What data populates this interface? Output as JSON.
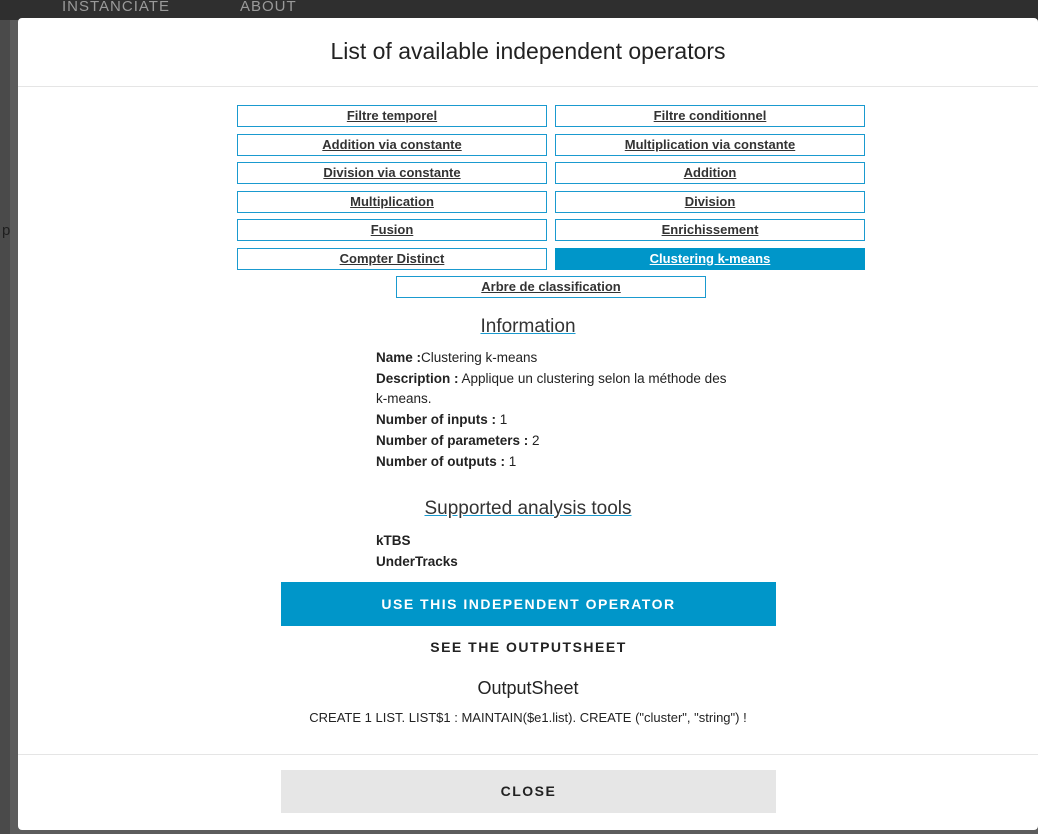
{
  "background": {
    "nav_items": [
      "INSTANCIATE",
      "ABOUT"
    ],
    "side_letter": "p"
  },
  "modal": {
    "title": "List of available independent operators",
    "operators": [
      "Filtre temporel",
      "Filtre conditionnel",
      "Addition via constante",
      "Multiplication via constante",
      "Division via constante",
      "Addition",
      "Multiplication",
      "Division",
      "Fusion",
      "Enrichissement",
      "Compter Distinct",
      "Clustering k-means",
      "Arbre de classification"
    ],
    "selected_operator": "Clustering k-means",
    "information": {
      "title": "Information",
      "name_label": "Name :",
      "name_value": "Clustering k-means",
      "description_label": "Description :",
      "description_value": " Applique un clustering selon la méthode des k-means.",
      "inputs_label": "Number of inputs :",
      "inputs_value": " 1",
      "parameters_label": "Number of parameters :",
      "parameters_value": " 2",
      "outputs_label": "Number of outputs :",
      "outputs_value": " 1"
    },
    "tools": {
      "title": "Supported analysis tools",
      "items": [
        "kTBS",
        "UnderTracks"
      ]
    },
    "use_button": "USE THIS INDEPENDENT OPERATOR",
    "see_button": "SEE THE OUTPUTSHEET",
    "output_title": "OutputSheet",
    "output_text": "CREATE 1 LIST. LIST$1 : MAINTAIN($e1.list). CREATE (\"cluster\", \"string\") !",
    "close_button": "CLOSE"
  },
  "colors": {
    "accent": "#0096c9",
    "border": "#1a9acf",
    "close_bg": "#e6e6e6"
  }
}
